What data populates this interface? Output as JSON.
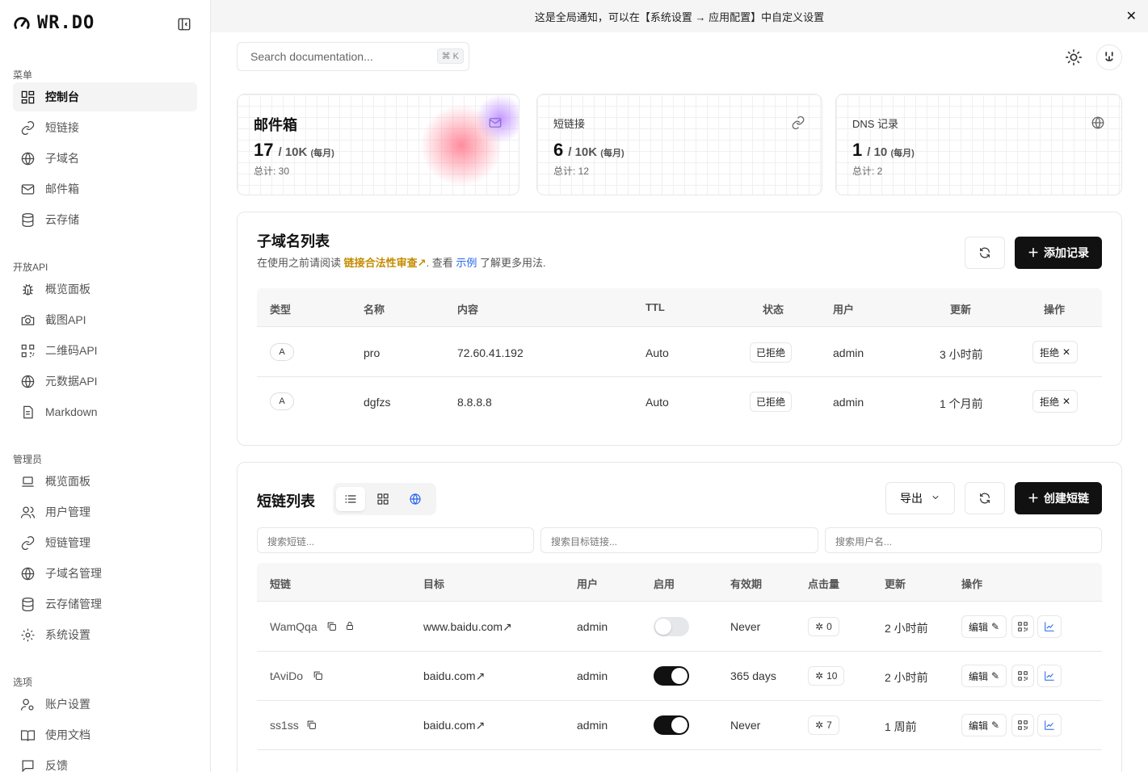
{
  "app": {
    "brand": "WR.DO"
  },
  "sidebar": {
    "sections": [
      {
        "title": "菜单",
        "items": [
          "控制台",
          "短链接",
          "子域名",
          "邮件箱",
          "云存储"
        ]
      },
      {
        "title": "开放API",
        "items": [
          "概览面板",
          "截图API",
          "二维码API",
          "元数据API",
          "Markdown"
        ]
      },
      {
        "title": "管理员",
        "items": [
          "概览面板",
          "用户管理",
          "短链管理",
          "子域名管理",
          "云存储管理",
          "系统设置"
        ]
      },
      {
        "title": "选项",
        "items": [
          "账户设置",
          "使用文档",
          "反馈"
        ]
      }
    ],
    "active": "控制台"
  },
  "banner": {
    "text": "这是全局通知，可以在【系统设置 → 应用配置】中自定义设置"
  },
  "search": {
    "placeholder": "Search documentation...",
    "shortcut": "⌘ K"
  },
  "stats": [
    {
      "title": "邮件箱",
      "value": "17",
      "limit": "/ 10K",
      "period": "(每月)",
      "total": "总计: 30",
      "icon": "mail-icon"
    },
    {
      "title": "短链接",
      "value": "6",
      "limit": "/ 10K",
      "period": "(每月)",
      "total": "总计: 12",
      "icon": "link-icon"
    },
    {
      "title": "DNS 记录",
      "value": "1",
      "limit": "/ 10",
      "period": "(每月)",
      "total": "总计: 2",
      "icon": "globe-lock-icon"
    }
  ],
  "domains": {
    "title": "子域名列表",
    "desc_prefix": "在使用之前请阅读",
    "desc_warn": "链接合法性审查↗",
    "desc_mid": ". 查看",
    "desc_link": "示例",
    "desc_suffix": "了解更多用法.",
    "add_label": "添加记录",
    "columns": [
      "类型",
      "名称",
      "内容",
      "TTL",
      "状态",
      "用户",
      "更新",
      "操作"
    ],
    "rows": [
      {
        "type": "A",
        "name": "pro",
        "content": "72.60.41.192",
        "ttl": "Auto",
        "status": "已拒绝",
        "user": "admin",
        "updated": "3 小时前",
        "action": "拒绝"
      },
      {
        "type": "A",
        "name": "dgfzs",
        "content": "8.8.8.8",
        "ttl": "Auto",
        "status": "已拒绝",
        "user": "admin",
        "updated": "1 个月前",
        "action": "拒绝"
      }
    ]
  },
  "links": {
    "title": "短链列表",
    "export_label": "导出",
    "create_label": "创建短链",
    "filters": [
      "搜索短链...",
      "搜索目标链接...",
      "搜索用户名..."
    ],
    "columns": [
      "短链",
      "目标",
      "用户",
      "启用",
      "有效期",
      "点击量",
      "更新",
      "操作"
    ],
    "edit_label": "编辑",
    "rows": [
      {
        "slug": "WamQqa",
        "target": "www.baidu.com",
        "user": "admin",
        "enabled": false,
        "expiry": "Never",
        "clicks": "0",
        "updated": "2 小时前",
        "locked": true
      },
      {
        "slug": "tAviDo",
        "target": "baidu.com",
        "user": "admin",
        "enabled": true,
        "expiry": "365 days",
        "clicks": "10",
        "updated": "2 小时前",
        "locked": false
      },
      {
        "slug": "ss1ss",
        "target": "baidu.com",
        "user": "admin",
        "enabled": true,
        "expiry": "Never",
        "clicks": "7",
        "updated": "1 周前",
        "locked": false
      }
    ]
  }
}
